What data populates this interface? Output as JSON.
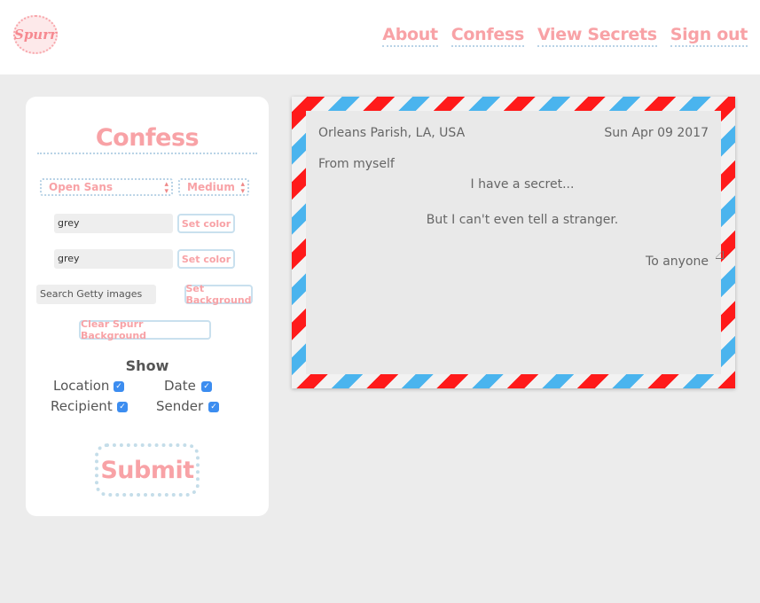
{
  "header": {
    "logo_text": "Spurr",
    "nav": [
      "About",
      "Confess",
      "View Secrets",
      "Sign out"
    ]
  },
  "panel": {
    "title": "Confess",
    "font_select": "Open Sans",
    "size_select": "Medium",
    "color1_value": "grey",
    "color2_value": "grey",
    "set_color_label": "Set color",
    "search_placeholder": "Search Getty images",
    "set_background_label": "Set Background",
    "clear_background_label": "Clear Spurr Background",
    "show_title": "Show",
    "checkboxes": {
      "location": {
        "label": "Location",
        "checked": true
      },
      "date": {
        "label": "Date",
        "checked": true
      },
      "recipient": {
        "label": "Recipient",
        "checked": true
      },
      "sender": {
        "label": "Sender",
        "checked": true
      }
    },
    "submit_label": "Submit"
  },
  "envelope": {
    "location": "Orleans Parish, LA, USA",
    "date": "Sun Apr 09 2017",
    "from": "From myself",
    "message_line1": "I have a secret...",
    "message_line2": "But I can't even tell a stranger.",
    "to": "To anyone"
  },
  "colors": {
    "accent_pink": "#f8a2a6",
    "dotted_blue": "#b9d3e6",
    "stripe_red": "#ff1a1a",
    "stripe_blue": "#4ab4ee",
    "checkbox_blue": "#3c8df0"
  }
}
